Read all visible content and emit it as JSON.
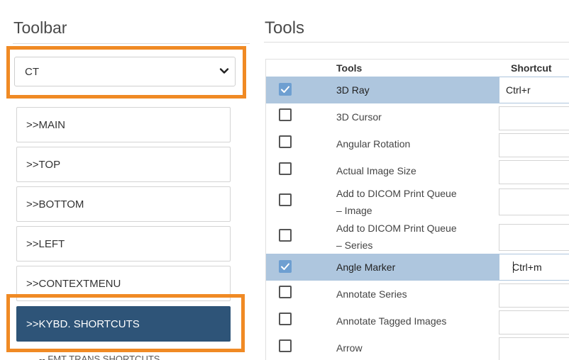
{
  "toolbar": {
    "title": "Toolbar",
    "select": {
      "value": "CT"
    },
    "buttons": [
      {
        "label": ">>MAIN"
      },
      {
        "label": ">>TOP"
      },
      {
        "label": ">>BOTTOM"
      },
      {
        "label": ">>LEFT"
      },
      {
        "label": ">>CONTEXTMENU"
      },
      {
        "label": ">>KYBD. SHORTCUTS"
      }
    ],
    "partial_label": "-- FMT TRANS SHORTCUTS"
  },
  "tools": {
    "title": "Tools",
    "columns": {
      "tools": "Tools",
      "shortcut": "Shortcut"
    },
    "rows": [
      {
        "name": "3D Ray",
        "shortcut": "Ctrl+r",
        "checked": true
      },
      {
        "name": "3D Cursor",
        "shortcut": "",
        "checked": false
      },
      {
        "name": "Angular Rotation",
        "shortcut": "",
        "checked": false
      },
      {
        "name": "Actual Image Size",
        "shortcut": "",
        "checked": false
      },
      {
        "name_line1": "Add to DICOM Print Queue",
        "name_line2": "– Image",
        "shortcut": "",
        "checked": false
      },
      {
        "name_line1": "Add to DICOM Print Queue",
        "name_line2": "– Series",
        "shortcut": "",
        "checked": false
      },
      {
        "name": "Angle Marker",
        "shortcut": "Ctrl+m",
        "checked": true
      },
      {
        "name": "Annotate Series",
        "shortcut": "",
        "checked": false
      },
      {
        "name": "Annotate Tagged Images",
        "shortcut": "",
        "checked": false
      },
      {
        "name": "Arrow",
        "shortcut": "",
        "checked": false
      }
    ]
  },
  "colors": {
    "highlight_border": "#f08a24",
    "active_button": "#2e5478",
    "selected_row": "#aec6de",
    "checkbox_checked": "#6e9fd1"
  }
}
